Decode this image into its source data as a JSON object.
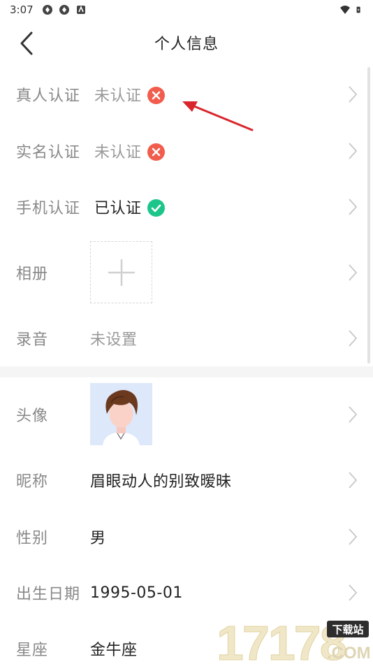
{
  "status_bar": {
    "time": "3:07",
    "left_icons": [
      "sync-icon",
      "sync-icon",
      "app-icon"
    ],
    "right_icons": [
      "wifi-icon",
      "battery-icon"
    ]
  },
  "header": {
    "title": "个人信息",
    "back_icon": "chevron-left-icon"
  },
  "rows": {
    "real_person": {
      "label": "真人认证",
      "value": "未认证",
      "status": "unverified"
    },
    "real_name": {
      "label": "实名认证",
      "value": "未认证",
      "status": "unverified"
    },
    "phone": {
      "label": "手机认证",
      "value": "已认证",
      "status": "verified"
    },
    "album": {
      "label": "相册",
      "add_icon": "plus-icon"
    },
    "voice": {
      "label": "录音",
      "value": "未设置"
    },
    "avatar": {
      "label": "头像",
      "image": "cartoon-boy-avatar"
    },
    "nickname": {
      "label": "昵称",
      "value": "眉眼动人的别致暧昧"
    },
    "gender": {
      "label": "性别",
      "value": "男"
    },
    "birthday": {
      "label": "出生日期",
      "value": "1995-05-01"
    },
    "zodiac": {
      "label": "星座",
      "value": "金牛座"
    }
  },
  "colors": {
    "unverified_badge": "#f25c4c",
    "verified_badge": "#1cc58a",
    "annotation_arrow": "#d9262d",
    "label_grey": "#888888",
    "chevron": "#c8c8c8"
  },
  "watermark": {
    "number": "17178",
    "tag": "下载站",
    "suffix": ".COM"
  }
}
